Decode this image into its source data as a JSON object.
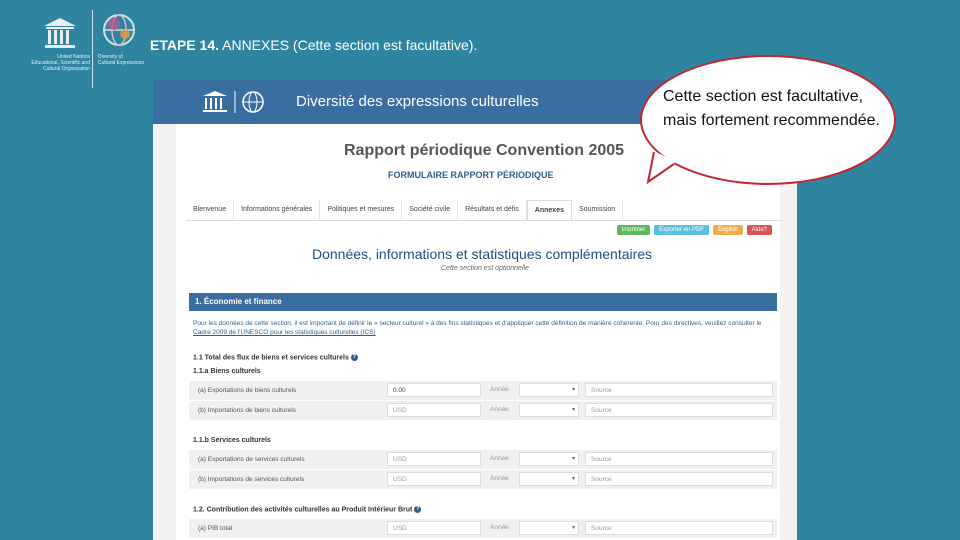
{
  "slide": {
    "title_bold": "ETAPE 14.",
    "title_rest": " ANNEXES (Cette section est facultative).",
    "logo_left": [
      "United Nations",
      "Educational, Scientific and",
      "Cultural Organization"
    ],
    "logo_right": [
      "Diversity of",
      "Cultural Expressions"
    ]
  },
  "bubble": {
    "text": "Cette section est facultative, mais fortement recommendée."
  },
  "app": {
    "site_name": "Diversité des expressions culturelles",
    "report_title": "Rapport périodique Convention 2005",
    "report_subtitle": "FORMULAIRE RAPPORT PÉRIODIQUE",
    "tabs": [
      "Bienvenue",
      "Informations générales",
      "Politiques et mesures",
      "Société civile",
      "Résultats et défis",
      "Annexes",
      "Soumission"
    ],
    "active_tab": "Annexes",
    "actions": [
      {
        "label": "Imprimer",
        "color": "#5cb85c"
      },
      {
        "label": "Exporter en PDF",
        "color": "#5bc0de"
      },
      {
        "label": "English",
        "color": "#f0ad4e"
      },
      {
        "label": "Aide?",
        "color": "#d9534f"
      }
    ],
    "section_heading": "Données, informations et statistiques complémentaires",
    "section_note": "Cette section est optionnelle",
    "subsection_bar": "1. Économie et finance",
    "intro_text": "Pour les données de cette section, il est important de définir le « secteur culturel » à des fins statistiques et d'appliquer cette définition de manière cohérente. Pour des directives, veuillez consulter le ",
    "intro_link": "Cadre 2009 de l'UNESCO pour les statistiques culturelles (ICS)",
    "q1": "1.1 Total des flux de biens et services culturels",
    "q1a": "1.1.a Biens culturels",
    "q1b": "1.1.b Services culturels",
    "q2": "1.2. Contribution des activités culturelles au Produit Intérieur Brut",
    "rows": [
      {
        "label": "(a) Exportations de biens culturels",
        "value": "0.00",
        "year": "Année",
        "source": "Source"
      },
      {
        "label": "(b) Importations de biens culturels",
        "value": "USD",
        "year": "Année",
        "source": "Source"
      },
      {
        "label": "(a) Exportations de services culturels",
        "value": "USD",
        "year": "Année",
        "source": "Source"
      },
      {
        "label": "(b) Importations de services culturels",
        "value": "USD",
        "year": "Année",
        "source": "Source"
      },
      {
        "label": "(a) PIB total",
        "value": "USD",
        "year": "Année",
        "source": "Source"
      }
    ]
  }
}
